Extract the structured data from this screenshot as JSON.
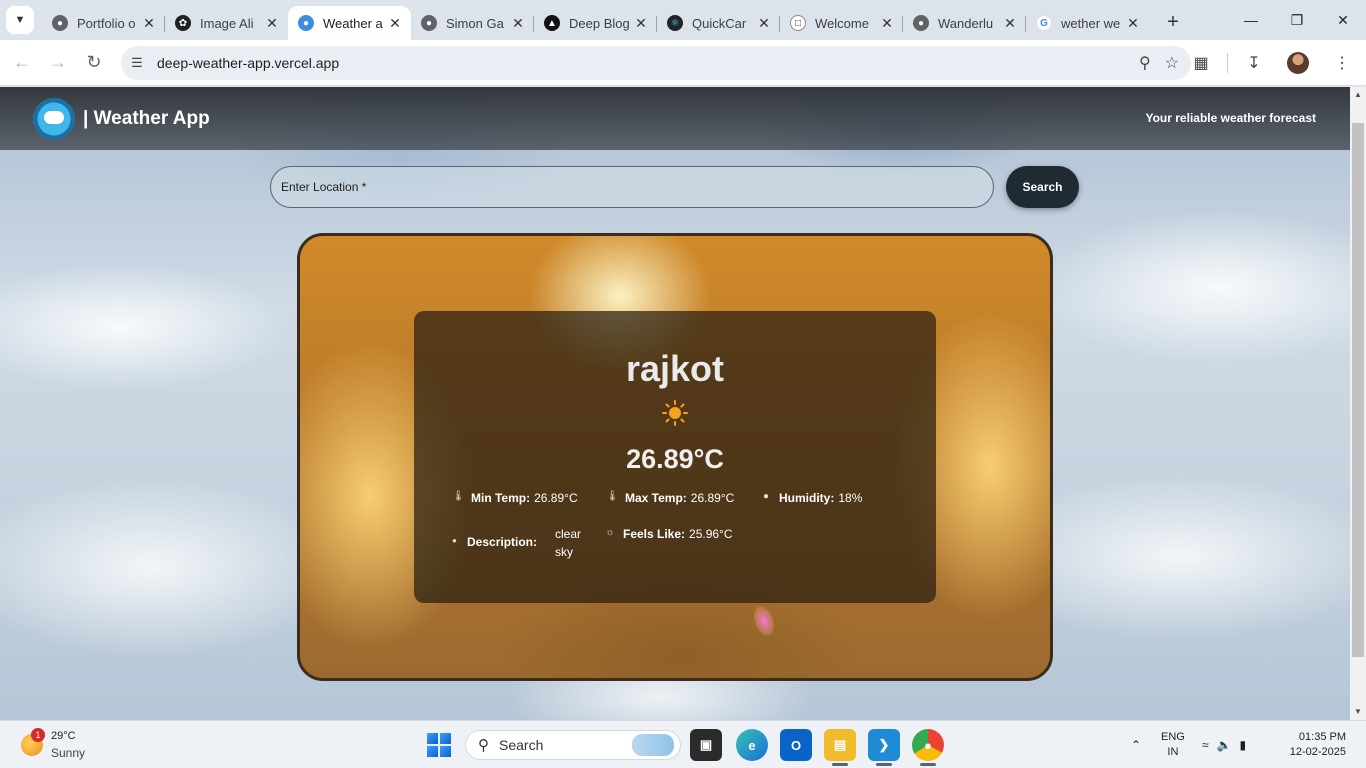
{
  "browser": {
    "tabs": [
      {
        "title": "Portfolio o",
        "favicon": "globe-icon",
        "active": false
      },
      {
        "title": "Image Ali",
        "favicon": "chatgpt-icon",
        "active": false
      },
      {
        "title": "Weather a",
        "favicon": "globe-icon",
        "active": true
      },
      {
        "title": "Simon Ga",
        "favicon": "globe-icon",
        "active": false
      },
      {
        "title": "Deep Blog",
        "favicon": "triangle-icon",
        "active": false
      },
      {
        "title": "QuickCar",
        "favicon": "react-icon",
        "active": false
      },
      {
        "title": "Welcome",
        "favicon": "chat-icon",
        "active": false
      },
      {
        "title": "Wanderlu",
        "favicon": "globe-icon",
        "active": false
      },
      {
        "title": "wether we",
        "favicon": "google-icon",
        "active": false
      }
    ],
    "url": "deep-weather-app.vercel.app"
  },
  "app": {
    "title": "| Weather App",
    "tagline": "Your reliable weather forecast",
    "search": {
      "placeholder": "Enter Location *",
      "button_label": "Search"
    },
    "weather": {
      "city": "rajkot",
      "icon": "sun-icon",
      "temperature": "26.89°C",
      "min_temp_label": "Min Temp:",
      "min_temp_value": "26.89°C",
      "max_temp_label": "Max Temp:",
      "max_temp_value": "26.89°C",
      "humidity_label": "Humidity:",
      "humidity_value": "18%",
      "description_label": "Description:",
      "description_value": "clear sky",
      "feels_like_label": "Feels Like:",
      "feels_like_value": "25.96°C"
    }
  },
  "taskbar": {
    "weather_temp": "29°C",
    "weather_condition": "Sunny",
    "weather_badge": "1",
    "search_placeholder": "Search",
    "language": "ENG",
    "region": "IN",
    "time": "01:35 PM",
    "date": "12-02-2025"
  },
  "colors": {
    "header_bg": "#2a2e33",
    "search_button_bg": "#1f2a33",
    "card_border": "#3b2c1c",
    "panel_bg": "#281e12"
  }
}
